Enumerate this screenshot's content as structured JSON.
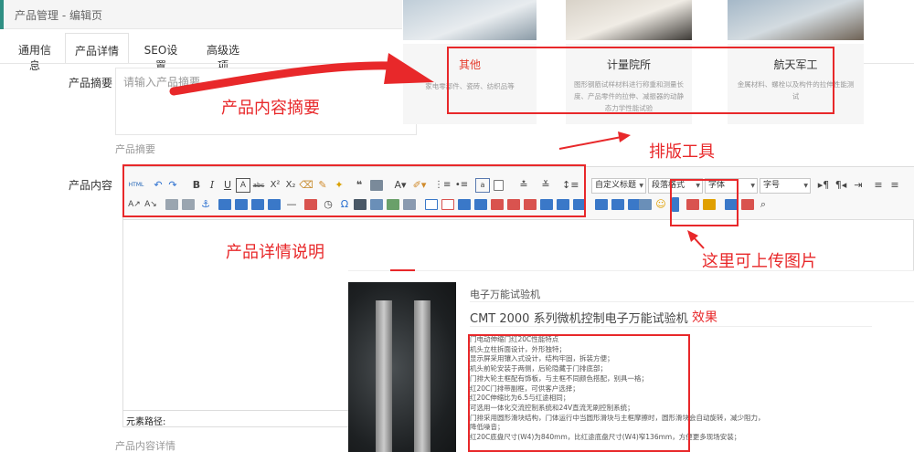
{
  "breadcrumb": "产品管理 - 编辑页",
  "tabs": [
    "通用信息",
    "产品详情",
    "SEO设置",
    "高级选项"
  ],
  "summary": {
    "label": "产品摘要",
    "placeholder": "请输入产品摘要",
    "help": "产品摘要"
  },
  "content": {
    "label": "产品内容",
    "help": "产品内容详情",
    "element_path": "元素路径:"
  },
  "toolbar": {
    "dropdowns": [
      "自定义标题",
      "段落格式",
      "字体",
      "字号"
    ],
    "html_label": "HTML"
  },
  "banner": {
    "cards": [
      {
        "title": "其他",
        "desc": "家电零部件、瓷砖、纺织品等"
      },
      {
        "title": "计量院所",
        "desc": "图形钢筋试样材料进行称重和测量长度、产品零件的拉伸、减振器的动静态力学性能试验"
      },
      {
        "title": "航天军工",
        "desc": "金属材料、螺栓以及构件的拉伸性能测试"
      }
    ]
  },
  "annotations": {
    "summary": "产品内容摘要",
    "toolbar": "排版工具",
    "detail": "产品详情说明",
    "upload": "这里可上传图片",
    "effect": "效果"
  },
  "result": {
    "category": "电子万能试验机",
    "title": "CMT 2000 系列微机控制电子万能试验机",
    "items": [
      "门电动伸缩门红20C性能特点",
      "机头立柱拆面设计，外形独特；",
      "显示屏采用镶入式设计，结构牢固，拆装方便；",
      "机头前轮安装于两侧，后轮隐藏于门排底部；",
      "门排大轮主框配有饰板，与主框不同颜色搭配，别具一格；",
      "红20C门排带副框，可供客户选择；",
      "红20C伸缩比为6.5与红途相同；",
      "可选用一体化交流控制系统和24V直流无刷控制系统；",
      "门排采用圆形滑块结构，门体运行中当圆形滑块与主框摩擦时，圆形滑块会自动旋转，减少阻力，",
      "降低噪音；",
      "红20C底盘尺寸(W4)为840mm，比红途底盘尺寸(W4)窄136mm，方便更多现场安装；"
    ]
  },
  "colors": {
    "annotation": "#e8282a",
    "accent": "#2f8f83"
  }
}
